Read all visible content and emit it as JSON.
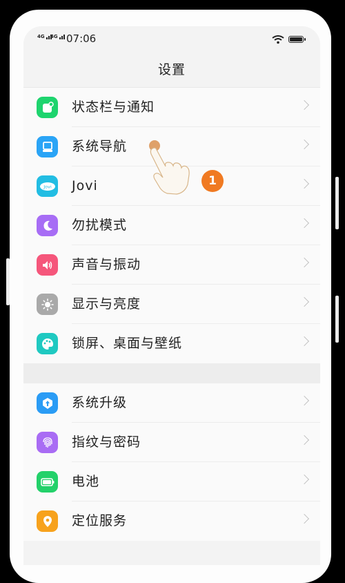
{
  "status_bar": {
    "sim1": "4G",
    "sim2": "4G",
    "time": "07:06",
    "wifi_icon": "wifi-icon",
    "battery_icon": "battery-icon"
  },
  "header": {
    "title": "设置"
  },
  "settings_group_1": [
    {
      "label": "状态栏与通知",
      "icon": "notification-icon",
      "color": "#1ed46e"
    },
    {
      "label": "系统导航",
      "icon": "navigation-icon",
      "color": "#2aa4f6"
    },
    {
      "label": "Jovi",
      "icon": "jovi-icon",
      "color": "#22bde3"
    },
    {
      "label": "勿扰模式",
      "icon": "moon-icon",
      "color": "#a76df5"
    },
    {
      "label": "声音与振动",
      "icon": "speaker-icon",
      "color": "#f5567b"
    },
    {
      "label": "显示与亮度",
      "icon": "brightness-icon",
      "color": "#a9a9a9"
    },
    {
      "label": "锁屏、桌面与壁纸",
      "icon": "palette-icon",
      "color": "#1fc9c1"
    }
  ],
  "settings_group_2": [
    {
      "label": "系统升级",
      "icon": "upgrade-icon",
      "color": "#2a9cf5"
    },
    {
      "label": "指纹与密码",
      "icon": "fingerprint-icon",
      "color": "#a96cf4"
    },
    {
      "label": "电池",
      "icon": "battery-icon",
      "color": "#23d16a"
    },
    {
      "label": "定位服务",
      "icon": "location-icon",
      "color": "#f7a21d"
    }
  ],
  "tutorial": {
    "step_number": "1",
    "badge_color": "#f07a22"
  }
}
